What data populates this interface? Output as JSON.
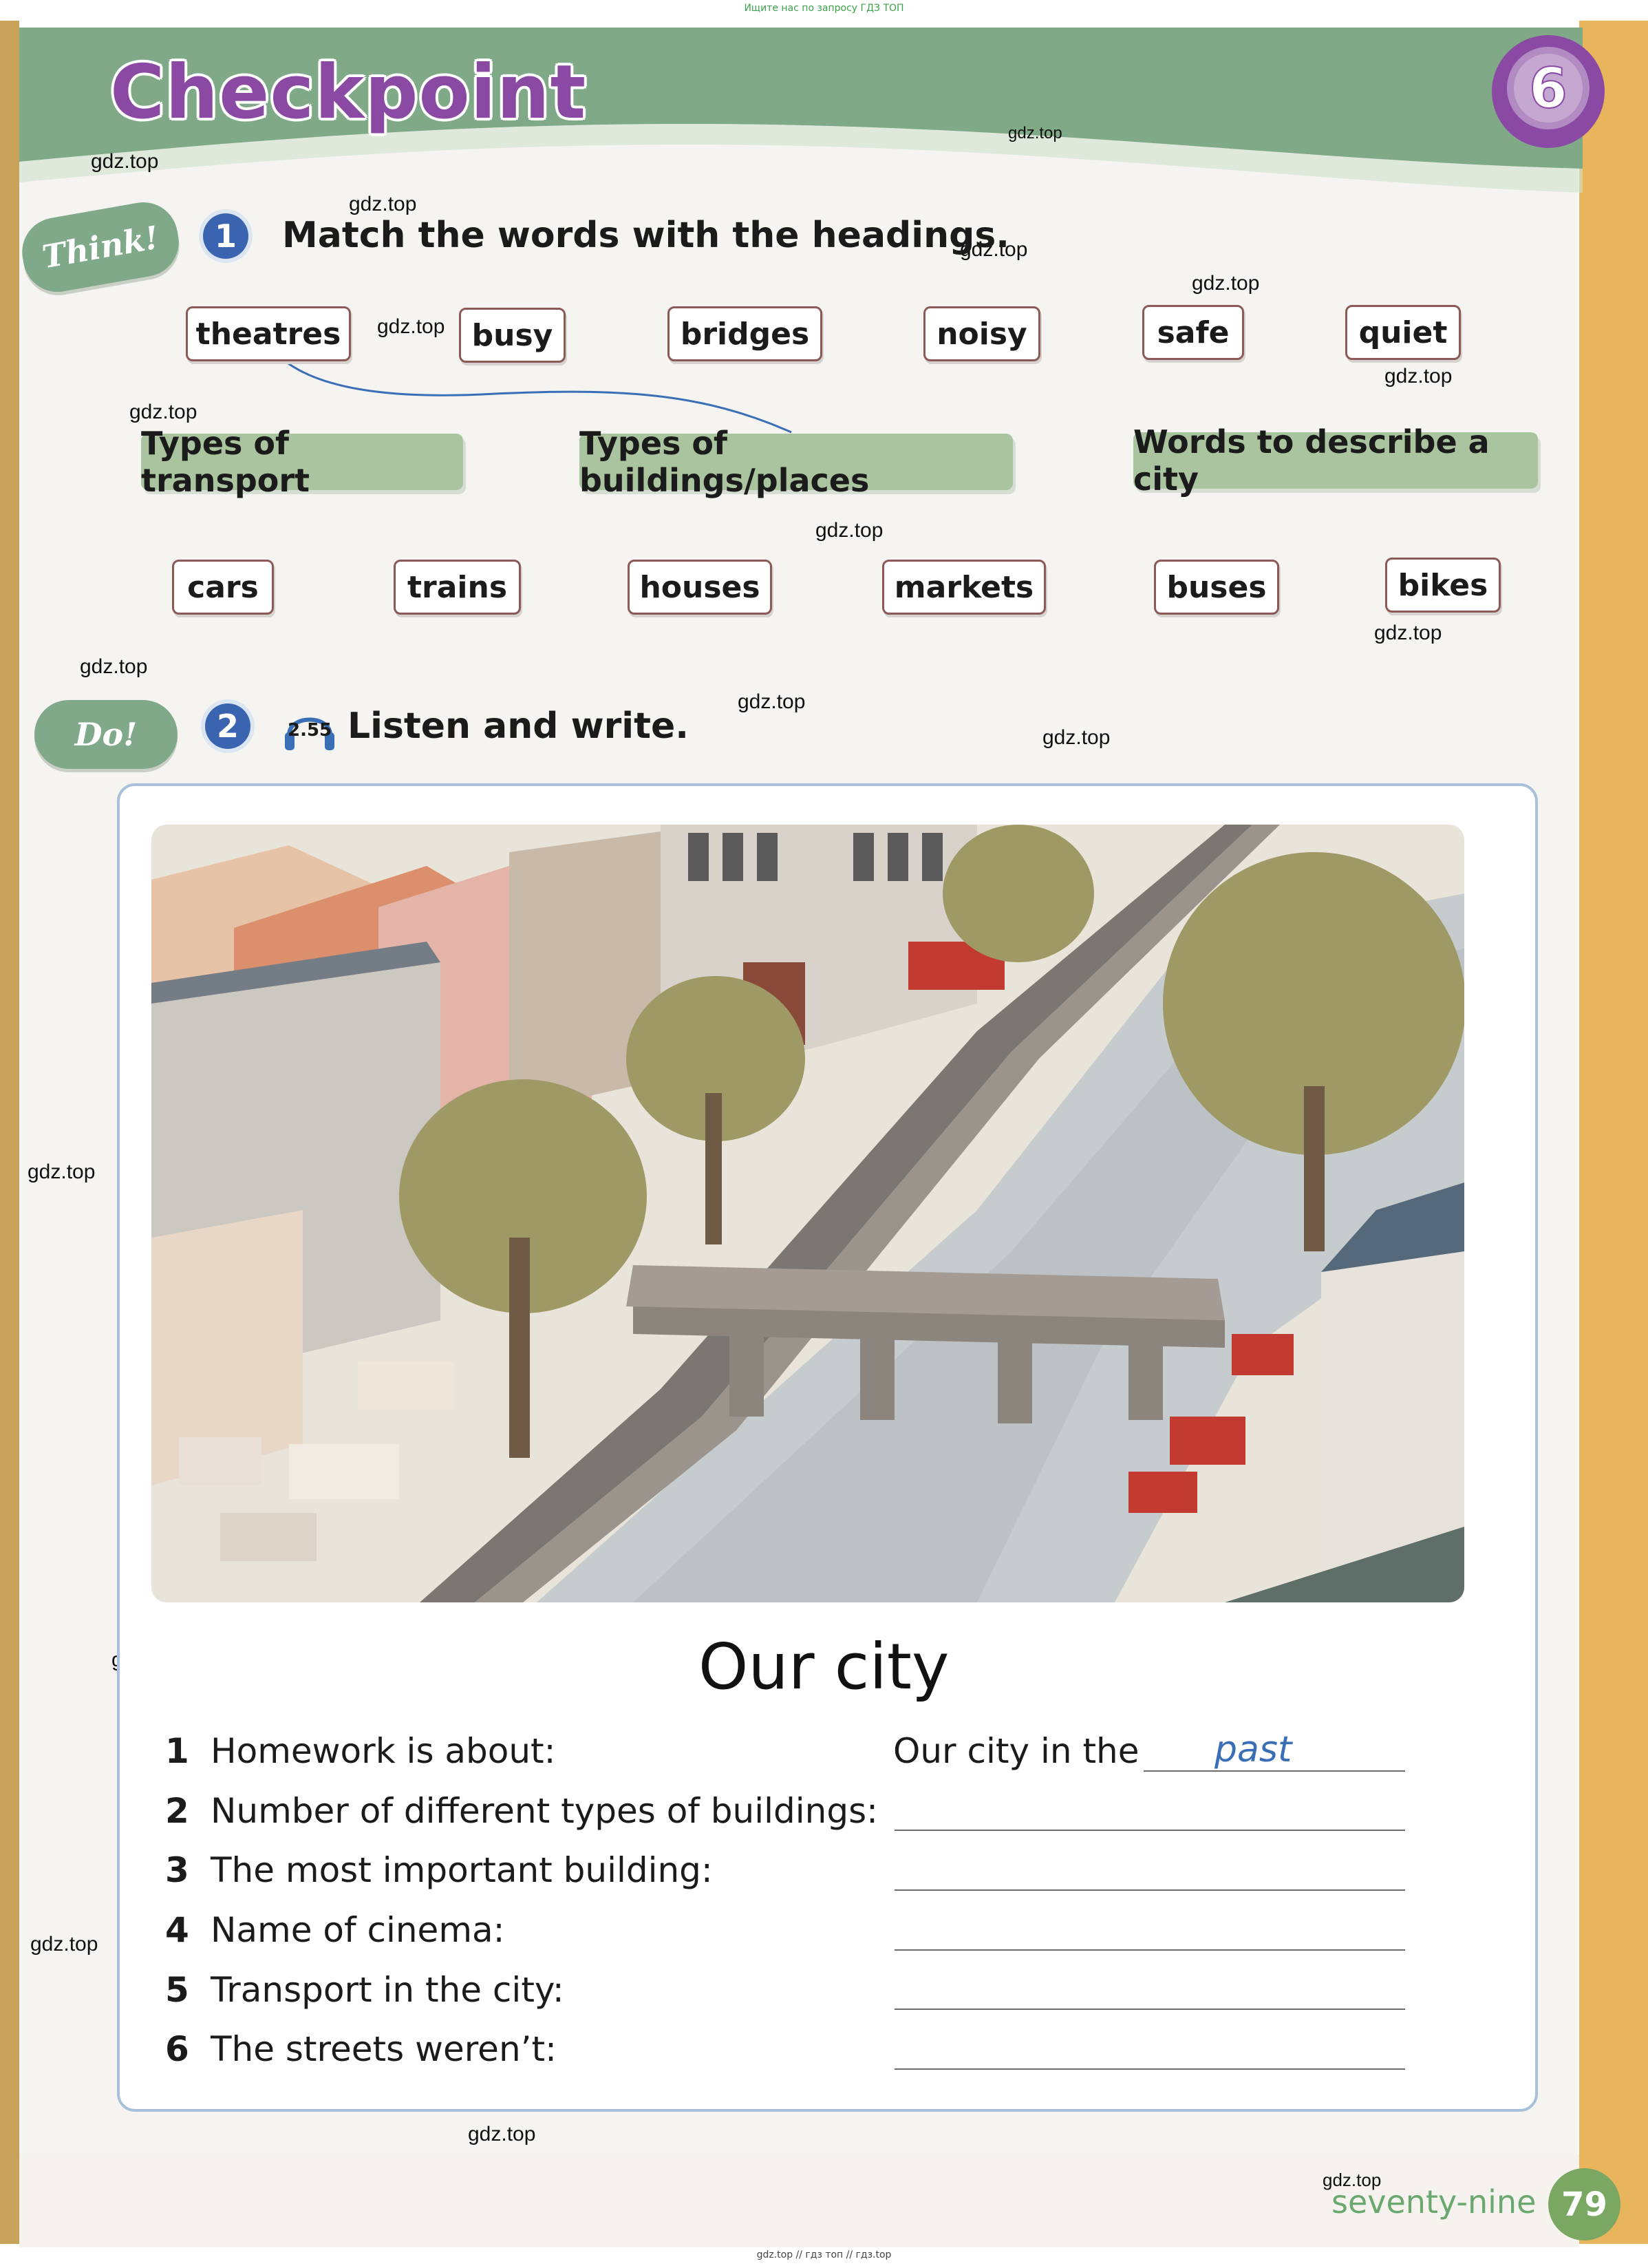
{
  "watermarks": {
    "top_banner": "Ищите нас по запросу ГДЗ ТОП",
    "bottom_banner": "gdz.top // гдз топ // гдз.top",
    "site": "gdz.top"
  },
  "header": {
    "title": "Checkpoint",
    "unit_number": "6",
    "colors": {
      "band": "#7fa987",
      "title": "#8a4aa4",
      "badge": "#8a4aa4"
    }
  },
  "exercise1": {
    "tag": "Think!",
    "number": "1",
    "instruction": "Match the words with the headings.",
    "top_words": [
      "theatres",
      "busy",
      "bridges",
      "noisy",
      "safe",
      "quiet"
    ],
    "headings": [
      "Types of transport",
      "Types of buildings/places",
      "Words to describe a city"
    ],
    "bottom_words": [
      "cars",
      "trains",
      "houses",
      "markets",
      "buses",
      "bikes"
    ]
  },
  "exercise2": {
    "tag": "Do!",
    "number": "2",
    "track": "2.55",
    "instruction": "Listen and write.",
    "title": "Our city",
    "questions": [
      {
        "num": "1",
        "text": "Homework is about:",
        "lead": "Our city in the",
        "answer": "past"
      },
      {
        "num": "2",
        "text": "Number of different types of buildings:",
        "answer": ""
      },
      {
        "num": "3",
        "text": "The most important building:",
        "answer": ""
      },
      {
        "num": "4",
        "text": "Name of cinema:",
        "answer": ""
      },
      {
        "num": "5",
        "text": "Transport in the city:",
        "answer": ""
      },
      {
        "num": "6",
        "text": "The streets weren’t:",
        "answer": ""
      }
    ]
  },
  "footer": {
    "page_words": "seventy-nine",
    "page_number": "79"
  }
}
